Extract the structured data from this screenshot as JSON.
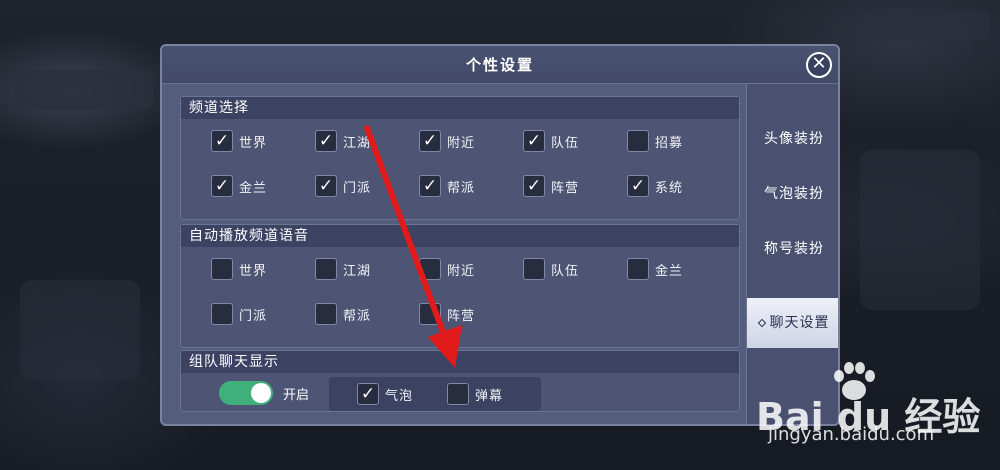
{
  "dialog": {
    "title": "个性设置",
    "close_icon": "close-icon"
  },
  "channel_select": {
    "header": "频道选择",
    "options": [
      {
        "label": "世界",
        "checked": true
      },
      {
        "label": "江湖",
        "checked": true
      },
      {
        "label": "附近",
        "checked": true
      },
      {
        "label": "队伍",
        "checked": true
      },
      {
        "label": "招募",
        "checked": false
      },
      {
        "label": "金兰",
        "checked": true
      },
      {
        "label": "门派",
        "checked": true
      },
      {
        "label": "帮派",
        "checked": true
      },
      {
        "label": "阵营",
        "checked": true
      },
      {
        "label": "系统",
        "checked": true
      }
    ]
  },
  "auto_voice": {
    "header": "自动播放频道语音",
    "options": [
      {
        "label": "世界",
        "checked": false
      },
      {
        "label": "江湖",
        "checked": false
      },
      {
        "label": "附近",
        "checked": false
      },
      {
        "label": "队伍",
        "checked": false
      },
      {
        "label": "金兰",
        "checked": false
      },
      {
        "label": "门派",
        "checked": false
      },
      {
        "label": "帮派",
        "checked": false
      },
      {
        "label": "阵营",
        "checked": false
      }
    ]
  },
  "team_chat": {
    "header": "组队聊天显示",
    "toggle_label": "开启",
    "toggle_on": true,
    "options": [
      {
        "label": "气泡",
        "checked": true
      },
      {
        "label": "弹幕",
        "checked": false
      }
    ]
  },
  "side_tabs": [
    {
      "label": "头像装扮",
      "active": false
    },
    {
      "label": "气泡装扮",
      "active": false
    },
    {
      "label": "称号装扮",
      "active": false
    },
    {
      "label": "聊天设置",
      "active": true
    }
  ],
  "watermark": {
    "logo_text": "Bai du 经验",
    "url": "jingyan.baidu.com"
  },
  "colors": {
    "toggle_on": "#3fb07a",
    "annotation_arrow": "#e11b1b",
    "panel": "#555d7d"
  }
}
